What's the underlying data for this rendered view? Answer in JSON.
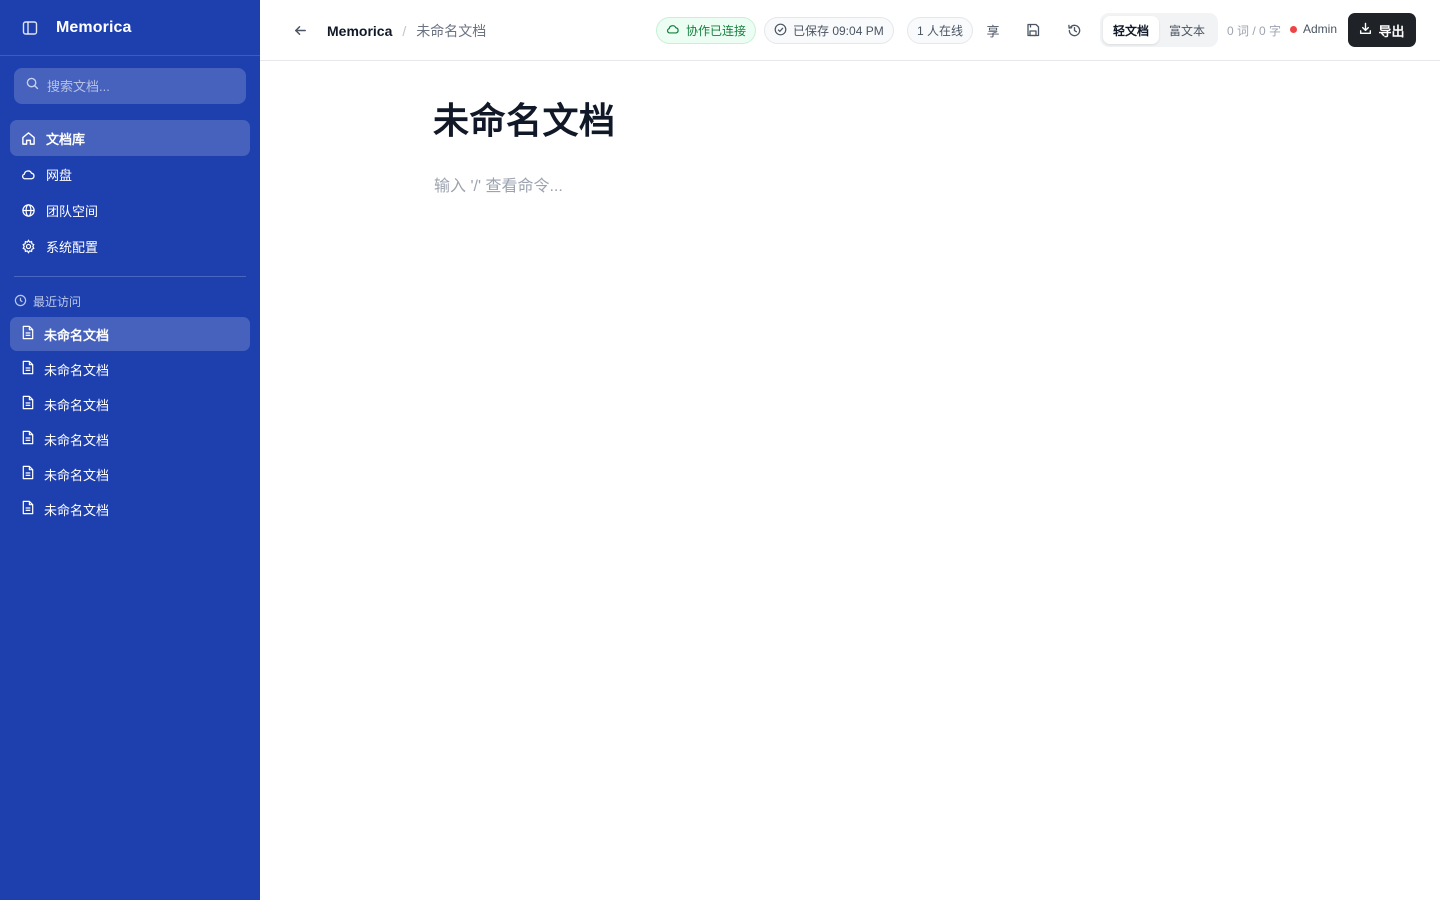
{
  "sidebar": {
    "app_name": "Memorica",
    "search": {
      "placeholder": "搜索文档...",
      "value": ""
    },
    "nav": [
      {
        "label": "文档库",
        "icon": "home-icon",
        "active": true
      },
      {
        "label": "网盘",
        "icon": "cloud-icon",
        "active": false
      },
      {
        "label": "团队空间",
        "icon": "globe-icon",
        "active": false
      },
      {
        "label": "系统配置",
        "icon": "gear-icon",
        "active": false
      }
    ],
    "recent_heading": "最近访问",
    "recent": [
      {
        "label": "未命名文档",
        "active": true
      },
      {
        "label": "未命名文档",
        "active": false
      },
      {
        "label": "未命名文档",
        "active": false
      },
      {
        "label": "未命名文档",
        "active": false
      },
      {
        "label": "未命名文档",
        "active": false
      },
      {
        "label": "未命名文档",
        "active": false
      }
    ]
  },
  "topbar": {
    "breadcrumb_root": "Memorica",
    "breadcrumb_sep": "/",
    "breadcrumb_current": "未命名文档",
    "collab_status": "协作已连接",
    "save_status": "已保存 09:04 PM",
    "online_count": "1 人在线",
    "share_label": "享",
    "mode_options": [
      "轻文档",
      "富文本"
    ],
    "mode_selected": "轻文档",
    "word_count": "0 词 / 0 字",
    "user_name": "Admin",
    "export_label": "导出"
  },
  "editor": {
    "title": "未命名文档",
    "placeholder": "输入 '/' 查看命令..."
  },
  "colors": {
    "sidebar_bg": "#1e40af",
    "collab_green": "#15803d",
    "status_dot": "#ef4444",
    "export_bg": "#1f2328"
  }
}
